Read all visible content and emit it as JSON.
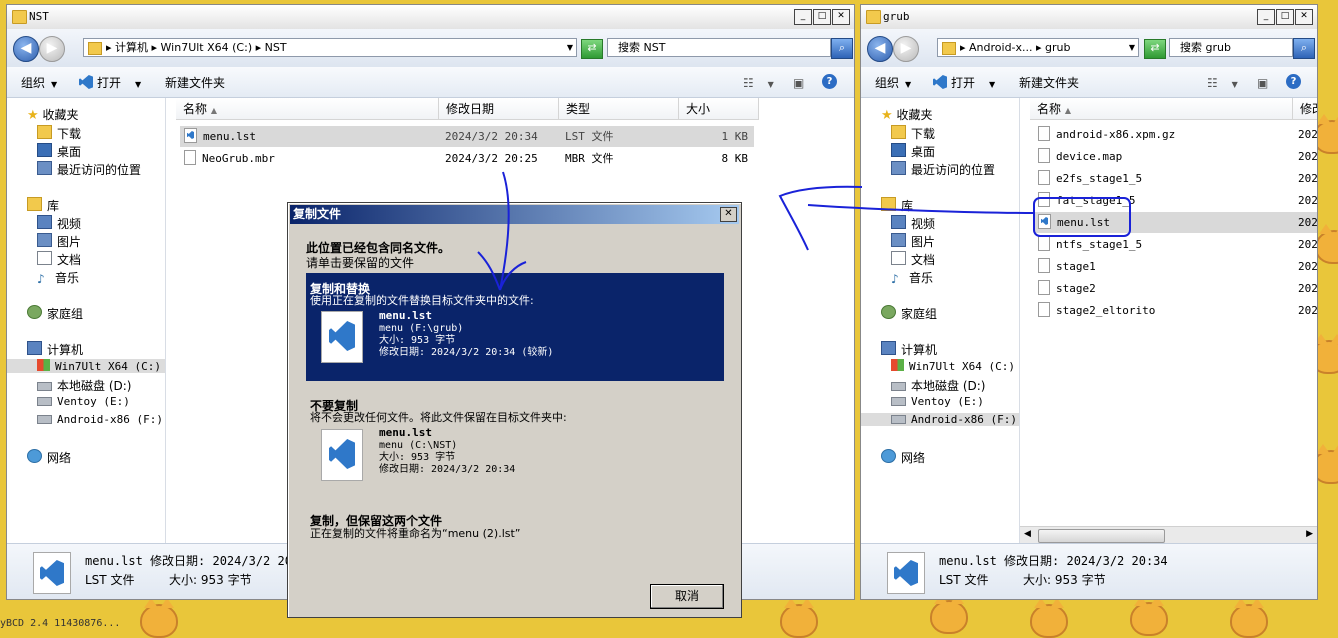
{
  "left_window": {
    "title": "NST",
    "address": "▸ 计算机 ▸ Win7Ult X64 (C:) ▸ NST",
    "search_placeholder": "搜索 NST",
    "toolbar": {
      "organize": "组织",
      "open": "打开",
      "new_folder": "新建文件夹"
    },
    "nav": {
      "favorites": "收藏夹",
      "downloads": "下载",
      "desktop": "桌面",
      "recent": "最近访问的位置",
      "libraries": "库",
      "videos": "视频",
      "pictures": "图片",
      "documents": "文档",
      "music": "音乐",
      "homegroup": "家庭组",
      "computer": "计算机",
      "drive_c": "Win7Ult X64 (C:)",
      "drive_d": "本地磁盘 (D:)",
      "drive_e": "Ventoy (E:)",
      "drive_f": "Android-x86 (F:)",
      "network": "网络"
    },
    "columns": {
      "name": "名称",
      "date": "修改日期",
      "type": "类型",
      "size": "大小"
    },
    "files": [
      {
        "name": "menu.lst",
        "date": "2024/3/2 20:34",
        "type": "LST 文件",
        "size": "1 KB"
      },
      {
        "name": "NeoGrub.mbr",
        "date": "2024/3/2 20:25",
        "type": "MBR 文件",
        "size": "8 KB"
      }
    ],
    "status": {
      "line1": "menu.lst 修改日期: 2024/3/2 20:34",
      "type": "LST 文件",
      "size": "大小: 953 字节"
    }
  },
  "right_window": {
    "title": "grub",
    "address": "▸ Android-x... ▸ grub",
    "search_placeholder": "搜索 grub",
    "toolbar": {
      "organize": "组织",
      "open": "打开",
      "new_folder": "新建文件夹"
    },
    "nav": {
      "favorites": "收藏夹",
      "downloads": "下载",
      "desktop": "桌面",
      "recent": "最近访问的位置",
      "libraries": "库",
      "videos": "视频",
      "pictures": "图片",
      "documents": "文档",
      "music": "音乐",
      "homegroup": "家庭组",
      "computer": "计算机",
      "drive_c": "Win7Ult X64 (C:)",
      "drive_d": "本地磁盘 (D:)",
      "drive_e": "Ventoy (E:)",
      "drive_f": "Android-x86 (F:)",
      "network": "网络"
    },
    "columns": {
      "name": "名称",
      "date": "修改"
    },
    "files": [
      {
        "name": "android-x86.xpm.gz",
        "date": "202"
      },
      {
        "name": "device.map",
        "date": "202"
      },
      {
        "name": "e2fs_stage1_5",
        "date": "202"
      },
      {
        "name": "fat_stage1_5",
        "date": "202"
      },
      {
        "name": "menu.lst",
        "date": "202"
      },
      {
        "name": "ntfs_stage1_5",
        "date": "202"
      },
      {
        "name": "stage1",
        "date": "202"
      },
      {
        "name": "stage2",
        "date": "202"
      },
      {
        "name": "stage2_eltorito",
        "date": "202"
      }
    ],
    "status": {
      "line1": "menu.lst 修改日期: 2024/3/2 20:34",
      "type": "LST 文件",
      "size": "大小: 953 字节"
    }
  },
  "dialog": {
    "title": "复制文件",
    "heading": "此位置已经包含同名文件。",
    "subheading": "请单击要保留的文件",
    "replace": {
      "title": "复制和替换",
      "desc": "使用正在复制的文件替换目标文件夹中的文件:",
      "file_name": "menu.lst",
      "file_path": "menu (F:\\grub)",
      "file_size": "大小: 953 字节",
      "file_date": "修改日期: 2024/3/2 20:34 (较新)"
    },
    "skip": {
      "title": "不要复制",
      "desc": "将不会更改任何文件。将此文件保留在目标文件夹中:",
      "file_name": "menu.lst",
      "file_path": "menu (C:\\NST)",
      "file_size": "大小: 953 字节",
      "file_date": "修改日期: 2024/3/2 20:34"
    },
    "keep_both": {
      "title": "复制，但保留这两个文件",
      "desc": "正在复制的文件将重命名为“menu (2).lst”"
    },
    "cancel": "取消"
  },
  "desktop": {
    "corner_text": "yBCD 2.4 11430876..."
  },
  "colors": {
    "dialog_selected": "#0a246a",
    "ink": "#1a22d8"
  }
}
